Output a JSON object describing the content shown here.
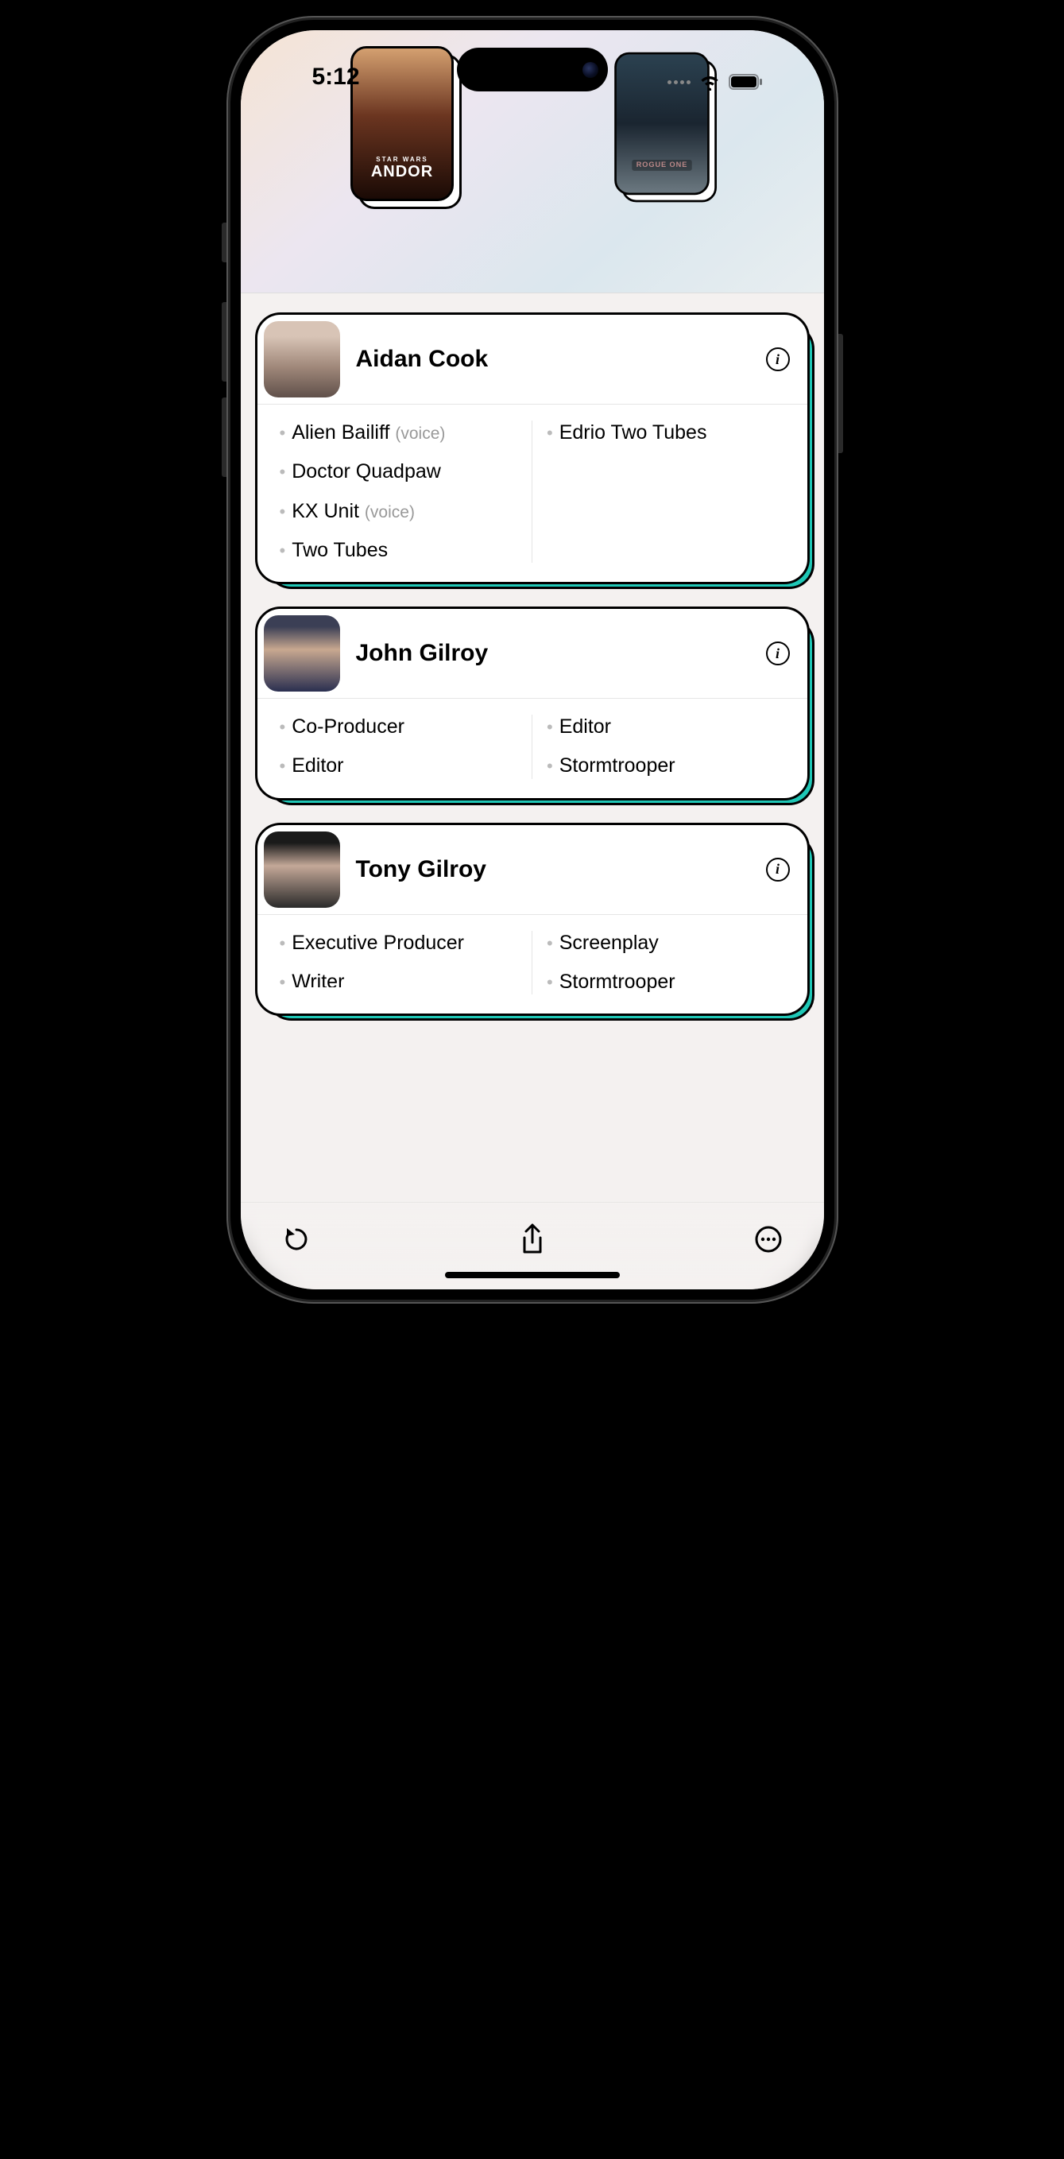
{
  "status": {
    "time": "5:12"
  },
  "posters": [
    {
      "label": "ANDOR",
      "sublabel": "STAR WARS"
    },
    {
      "label": "ROGUE ONE"
    }
  ],
  "people": [
    {
      "name": "Aidan Cook",
      "left_roles": [
        {
          "text": "Alien Bailiff",
          "qualifier": "(voice)"
        },
        {
          "text": "Doctor Quadpaw"
        },
        {
          "text": "KX Unit",
          "qualifier": "(voice)"
        },
        {
          "text": "Two Tubes"
        }
      ],
      "right_roles": [
        {
          "text": "Edrio Two Tubes"
        }
      ]
    },
    {
      "name": "John Gilroy",
      "left_roles": [
        {
          "text": "Co-Producer"
        },
        {
          "text": "Editor"
        }
      ],
      "right_roles": [
        {
          "text": "Editor"
        },
        {
          "text": "Stormtrooper"
        }
      ]
    },
    {
      "name": "Tony Gilroy",
      "left_roles": [
        {
          "text": "Executive Producer"
        },
        {
          "text": "Writer"
        }
      ],
      "right_roles": [
        {
          "text": "Screenplay"
        },
        {
          "text": "Stormtrooper"
        }
      ]
    }
  ]
}
